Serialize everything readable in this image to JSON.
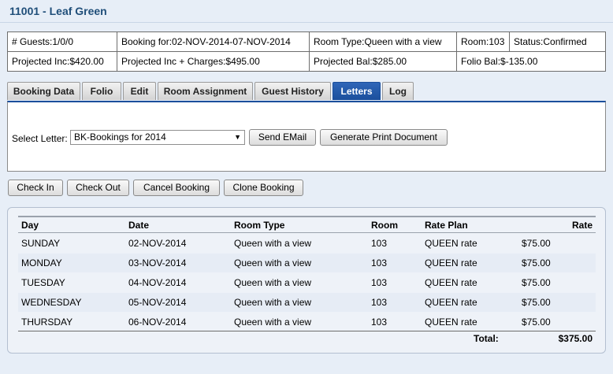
{
  "page_title": "11001 - Leaf Green",
  "info": {
    "row1": [
      "# Guests:1/0/0",
      "Booking for:02-NOV-2014-07-NOV-2014",
      "Room Type:Queen with a view",
      "Room:103",
      "Status:Confirmed"
    ],
    "row2": [
      "Projected Inc:$420.00",
      "Projected Inc + Charges:$495.00",
      "Projected Bal:$285.00",
      "Folio Bal:$-135.00"
    ]
  },
  "tabs": [
    "Booking Data",
    "Folio",
    "Edit",
    "Room Assignment",
    "Guest History",
    "Letters",
    "Log"
  ],
  "active_tab": "Letters",
  "letters": {
    "select_label": "Select Letter:",
    "selected": "BK-Bookings for 2014",
    "send_email": "Send EMail",
    "generate": "Generate Print Document"
  },
  "actions": [
    "Check In",
    "Check Out",
    "Cancel Booking",
    "Clone Booking"
  ],
  "grid": {
    "headers": [
      "Day",
      "Date",
      "Room Type",
      "Room",
      "Rate Plan",
      "Rate"
    ],
    "rows": [
      [
        "SUNDAY",
        "02-NOV-2014",
        "Queen with a view",
        "103",
        "QUEEN rate",
        "$75.00"
      ],
      [
        "MONDAY",
        "03-NOV-2014",
        "Queen with a view",
        "103",
        "QUEEN rate",
        "$75.00"
      ],
      [
        "TUESDAY",
        "04-NOV-2014",
        "Queen with a view",
        "103",
        "QUEEN rate",
        "$75.00"
      ],
      [
        "WEDNESDAY",
        "05-NOV-2014",
        "Queen with a view",
        "103",
        "QUEEN rate",
        "$75.00"
      ],
      [
        "THURSDAY",
        "06-NOV-2014",
        "Queen with a view",
        "103",
        "QUEEN rate",
        "$75.00"
      ]
    ],
    "total_label": "Total:",
    "total_value": "$375.00"
  },
  "colors": {
    "title": "#1f4e79",
    "active_tab": "#1b4f9c",
    "background": "#e7eef7"
  }
}
